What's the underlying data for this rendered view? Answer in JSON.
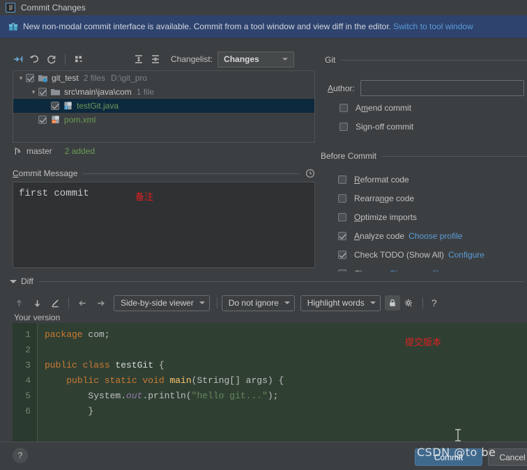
{
  "window": {
    "title": "Commit Changes",
    "logo_icon": "intellij-idea-logo-icon"
  },
  "banner": {
    "icon": "gift-icon",
    "text": "New non-modal commit interface is available. Commit from a tool window and view diff in the editor.",
    "link": "Switch to tool window"
  },
  "toolbar": {
    "show_diff_icon": "show-diff-icon",
    "rollback_icon": "rollback-undo-icon",
    "refresh_icon": "refresh-icon",
    "group_by_icon": "group-by-icon",
    "expand_all_icon": "expand-all-icon",
    "collapse_all_icon": "collapse-all-icon",
    "changelist_label": "Changelist:",
    "changelist_value": "Changes"
  },
  "tree": {
    "rows": [
      {
        "indent": 0,
        "twisty": "expanded",
        "checked": true,
        "icon": "module-folder-icon",
        "name": "git_test",
        "name_color": "default",
        "meta1": "2 files",
        "meta2": "D:\\git_pro",
        "selected": false
      },
      {
        "indent": 1,
        "twisty": "expanded",
        "checked": true,
        "icon": "folder-icon",
        "name": "src\\main\\java\\com",
        "name_color": "default",
        "meta1": "1 file",
        "meta2": "",
        "selected": false
      },
      {
        "indent": 2,
        "twisty": "none",
        "checked": true,
        "icon": "java-file-icon",
        "name": "testGit.java",
        "name_color": "green",
        "meta1": "",
        "meta2": "",
        "selected": true
      },
      {
        "indent": 1,
        "twisty": "none",
        "checked": true,
        "icon": "xml-file-icon",
        "name": "pom.xml",
        "name_color": "green",
        "meta1": "",
        "meta2": "",
        "selected": false
      }
    ]
  },
  "branch": {
    "icon": "git-branch-icon",
    "name": "master",
    "added": "2 added"
  },
  "commit_message": {
    "title": "Commit Message",
    "history_icon": "clock-history-icon",
    "value": "first commit",
    "placeholder": "",
    "annotation": "备注"
  },
  "git_section": {
    "title": "Git",
    "author_label": "Author:",
    "author_value": "",
    "author_placeholder": "",
    "checkboxes": [
      {
        "label": "Amend commit",
        "checked": false,
        "link": ""
      },
      {
        "label": "Sign-off commit",
        "checked": false,
        "link": ""
      }
    ]
  },
  "before_commit": {
    "title": "Before Commit",
    "checkboxes": [
      {
        "label": "Reformat code",
        "checked": false,
        "link": ""
      },
      {
        "label": "Rearrange code",
        "checked": false,
        "link": ""
      },
      {
        "label": "Optimize imports",
        "checked": false,
        "link": ""
      },
      {
        "label": "Analyze code",
        "checked": true,
        "link": "Choose profile"
      },
      {
        "label": "Check TODO (Show All)",
        "checked": true,
        "link": "Configure"
      },
      {
        "label": "Cleanup",
        "checked": false,
        "link": "Choose profile"
      }
    ]
  },
  "diff": {
    "title": "Diff",
    "prev_diff_icon": "arrow-up-icon",
    "next_diff_icon": "arrow-down-icon",
    "edit_icon": "pencil-edit-icon",
    "apply_left_icon": "arrow-left-icon",
    "apply_right_icon": "arrow-right-icon",
    "viewer_mode": "Side-by-side viewer",
    "ignore_mode": "Do not ignore",
    "highlight_mode": "Highlight words",
    "lock_icon": "lock-icon",
    "settings_icon": "gear-icon",
    "help_icon": "question-mark-icon",
    "version_label": "Your version",
    "annotation": "提交版本",
    "caret_icon": "text-caret-icon"
  },
  "code": {
    "line_numbers": [
      "1",
      "2",
      "3",
      "4",
      "5",
      "6"
    ],
    "lines": [
      [
        {
          "t": "package ",
          "c": "kw"
        },
        {
          "t": "com;",
          "c": "pln"
        }
      ],
      [],
      [
        {
          "t": "public class ",
          "c": "kw"
        },
        {
          "t": "testGit ",
          "c": "cls"
        },
        {
          "t": "{",
          "c": "pln"
        }
      ],
      [
        {
          "t": "    ",
          "c": "pln"
        },
        {
          "t": "public static void ",
          "c": "kw"
        },
        {
          "t": "main",
          "c": "fn"
        },
        {
          "t": "(String[] args) {",
          "c": "pln"
        }
      ],
      [
        {
          "t": "        System.",
          "c": "pln"
        },
        {
          "t": "out",
          "c": "fld"
        },
        {
          "t": ".println(",
          "c": "pln"
        },
        {
          "t": "\"hello git...\"",
          "c": "str"
        },
        {
          "t": ");",
          "c": "pln"
        }
      ],
      [
        {
          "t": "        }",
          "c": "pln"
        }
      ]
    ]
  },
  "bottom": {
    "help_label": "?",
    "commit_label": "Commit",
    "cancel_label": "Cancel",
    "watermark": "CSDN @to be"
  },
  "colors": {
    "background": "#3c3f41",
    "banner": "#2e436e",
    "accent_link": "#5b9bd9",
    "selection": "#0d293e",
    "added_green": "#6a9a57",
    "diff_added_bg": "#2f4033",
    "annotation_red": "#e02020",
    "commit_button": "#3f688d"
  }
}
